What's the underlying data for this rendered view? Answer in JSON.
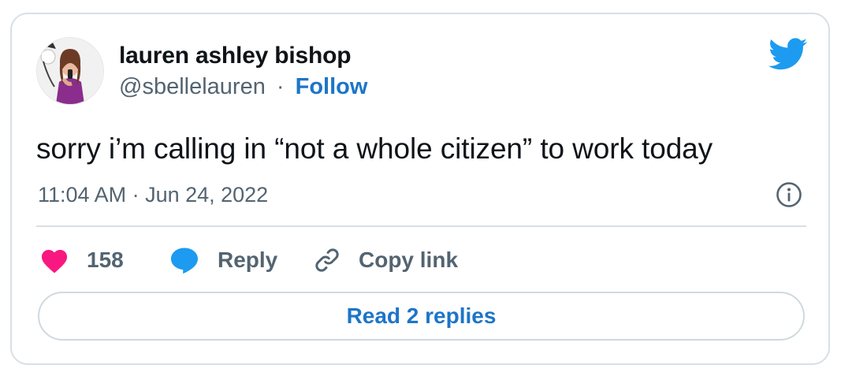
{
  "tweet": {
    "author": {
      "display_name": "lauren ashley bishop",
      "handle": "@sbellelauren",
      "separator": "·",
      "follow_label": "Follow"
    },
    "text": "sorry i’m calling in “not a whole citizen” to work today",
    "timestamp": "11:04 AM · Jun 24, 2022",
    "actions": {
      "like_count": "158",
      "reply_label": "Reply",
      "copy_link_label": "Copy link"
    },
    "read_replies_label": "Read 2 replies",
    "icons": {
      "brand": "twitter-bird-icon",
      "info": "info-icon",
      "like": "heart-icon",
      "reply": "speech-bubble-icon",
      "copy": "link-icon"
    },
    "colors": {
      "brand": "#1d9bf0",
      "link": "#1d75c8",
      "like": "#f91880",
      "secondary_text": "#536471",
      "border": "#d8dfe5"
    }
  }
}
